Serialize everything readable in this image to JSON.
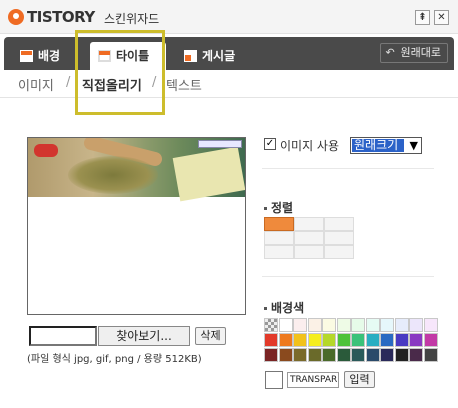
{
  "window": {
    "brand": "TISTORY",
    "app_name": "스킨위자드",
    "minimize_glyph": "⇞",
    "close_glyph": "✕"
  },
  "tabs": [
    {
      "label": "배경",
      "icon": "background-tab-icon"
    },
    {
      "label": "타이틀",
      "icon": "title-tab-icon",
      "active": true
    },
    {
      "label": "게시글",
      "icon": "post-tab-icon"
    }
  ],
  "restore_button": {
    "label": "원래대로",
    "icon_glyph": "↶"
  },
  "subtabs": [
    {
      "label": "이미지"
    },
    {
      "label": "직접올리기",
      "active": true
    },
    {
      "label": "텍스트"
    }
  ],
  "subtab_separator": "/",
  "upload": {
    "browse_label": "찾아보기...",
    "delete_label": "삭제",
    "hint": "(파일 형식 jpg, gif, png / 용량 512KB)"
  },
  "image_options": {
    "use_image_label": "이미지 사용",
    "use_image_checked": true,
    "checkmark": "✓",
    "size_select_value": "원래크기",
    "select_arrow": "▼"
  },
  "align": {
    "heading": "정렬",
    "selected": "top-left"
  },
  "bg_color": {
    "heading": "배경색",
    "input_value": "TRANSPARENT",
    "apply_label": "입력",
    "preview_color": "#ffffff",
    "rows": [
      [
        "transparent",
        "#ffffff",
        "#fbeeee",
        "#fbf1e6",
        "#fbfbe3",
        "#eefbe6",
        "#e6fbe9",
        "#e6fbf4",
        "#e6f7fb",
        "#e6ecfb",
        "#ece6fb",
        "#f7e6fb"
      ],
      [
        "#e23a2a",
        "#ee7a1e",
        "#f2c21b",
        "#f5ee1e",
        "#b5d82a",
        "#4ec23a",
        "#3ac27a",
        "#2aaec2",
        "#2a6ac2",
        "#4a3ac2",
        "#8a3ac2",
        "#c23aa6"
      ],
      [
        "#7a2424",
        "#8a4a1e",
        "#7a6a2a",
        "#6a6a2a",
        "#4a6a2a",
        "#2a5a3a",
        "#2a5a5a",
        "#2a4a6a",
        "#2a2a5a",
        "#222222",
        "#4a2a4a",
        "#444444"
      ]
    ]
  },
  "accent_colors": {
    "orange": "#ef6b23",
    "highlight_box": "#cdbd2c"
  }
}
